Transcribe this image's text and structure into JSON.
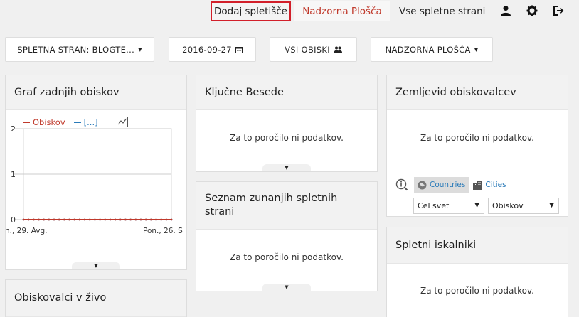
{
  "nav": {
    "add_site": "Dodaj spletišče",
    "dashboard": "Nadzorna Plošča",
    "all_sites": "Vse spletne strani"
  },
  "toolbar": {
    "site": "SPLETNA STRAN: BLOGTE...",
    "date": "2016-09-27",
    "visits": "VSI OBISKI",
    "dashboard": "NADZORNA PLOŠČA"
  },
  "widgets": {
    "visits_graph": {
      "title": "Graf zadnjih obiskov",
      "legend_visits": "Obiskov",
      "legend_other": "[...]"
    },
    "keywords": {
      "title": "Ključne Besede",
      "empty": "Za to poročilo ni podatkov."
    },
    "external": {
      "title": "Seznam zunanjih spletnih strani",
      "empty": "Za to poročilo ni podatkov."
    },
    "map": {
      "title": "Zemljevid obiskovalcev",
      "empty": "Za to poročilo ni podatkov.",
      "tab_countries": "Countries",
      "tab_cities": "Cities",
      "region_select": "Cel svet",
      "metric_select": "Obiskov"
    },
    "search_engines": {
      "title": "Spletni iskalniki",
      "empty": "Za to poročilo ni podatkov."
    },
    "live": {
      "title": "Obiskovalci v živo"
    }
  },
  "colors": {
    "accent_red": "#c0392b",
    "highlight_border": "#d21f2a",
    "series_blue": "#2b7bb9"
  },
  "chart_data": {
    "type": "line",
    "x_tick_labels": [
      "n., 29. Avg.",
      "Pon., 26. S"
    ],
    "ylim": [
      0,
      2
    ],
    "y_ticks": [
      0,
      1,
      2
    ],
    "series": [
      {
        "name": "Obiskov",
        "color": "#c0392b",
        "values": [
          0,
          0,
          0,
          0,
          0,
          0,
          0,
          0,
          0,
          0,
          0,
          0,
          0,
          0,
          0,
          0,
          0,
          0,
          0,
          0,
          0,
          0,
          0,
          0,
          0,
          0,
          0,
          0,
          0,
          0
        ]
      },
      {
        "name": "[...]",
        "color": "#2b7bb9",
        "values": [
          0,
          0,
          0,
          0,
          0,
          0,
          0,
          0,
          0,
          0,
          0,
          0,
          0,
          0,
          0,
          0,
          0,
          0,
          0,
          0,
          0,
          0,
          0,
          0,
          0,
          0,
          0,
          0,
          0,
          0
        ]
      }
    ],
    "grid": true
  }
}
